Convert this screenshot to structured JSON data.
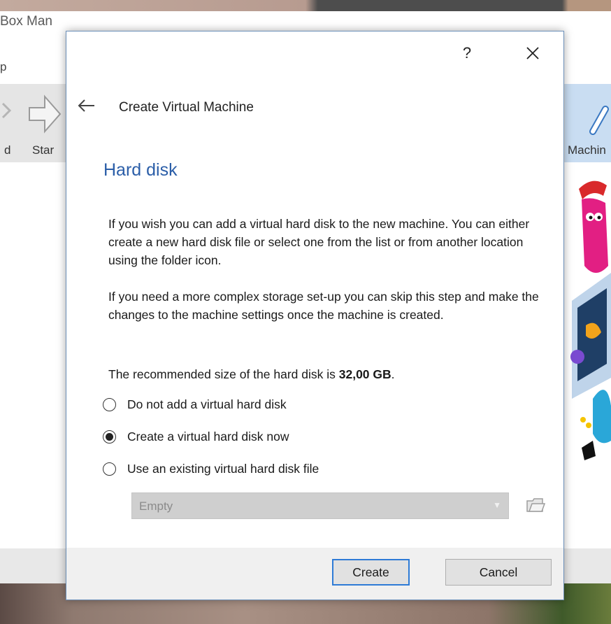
{
  "background_window": {
    "title": "Box Man",
    "menu": "p",
    "toolbar": {
      "new_label": "d",
      "start_label": "Star",
      "machine_label": "Machin"
    }
  },
  "dialog": {
    "help_label": "?",
    "title": "Create Virtual Machine",
    "page_title": "Hard disk",
    "paragraph1": "If you wish you can add a virtual hard disk to the new machine. You can either create a new hard disk file or select one from the list or from another location using the folder icon.",
    "paragraph2": "If you need a more complex storage set-up you can skip this step and make the changes to the machine settings once the machine is created.",
    "recommended_prefix": "The recommended size of the hard disk is ",
    "recommended_size": "32,00 GB",
    "recommended_suffix": ".",
    "options": [
      {
        "label": "Do not add a virtual hard disk",
        "selected": false
      },
      {
        "label": "Create a virtual hard disk now",
        "selected": true
      },
      {
        "label": "Use an existing virtual hard disk file",
        "selected": false
      }
    ],
    "disk_select": {
      "value": "Empty",
      "enabled": false
    },
    "buttons": {
      "create": "Create",
      "cancel": "Cancel"
    },
    "icons": {
      "back": "back-arrow-icon",
      "close": "close-icon",
      "folder": "folder-icon"
    }
  },
  "colors": {
    "accent_title": "#2b5ea8",
    "default_button_border": "#2e7bd6",
    "dialog_border": "#6b8fb8"
  }
}
